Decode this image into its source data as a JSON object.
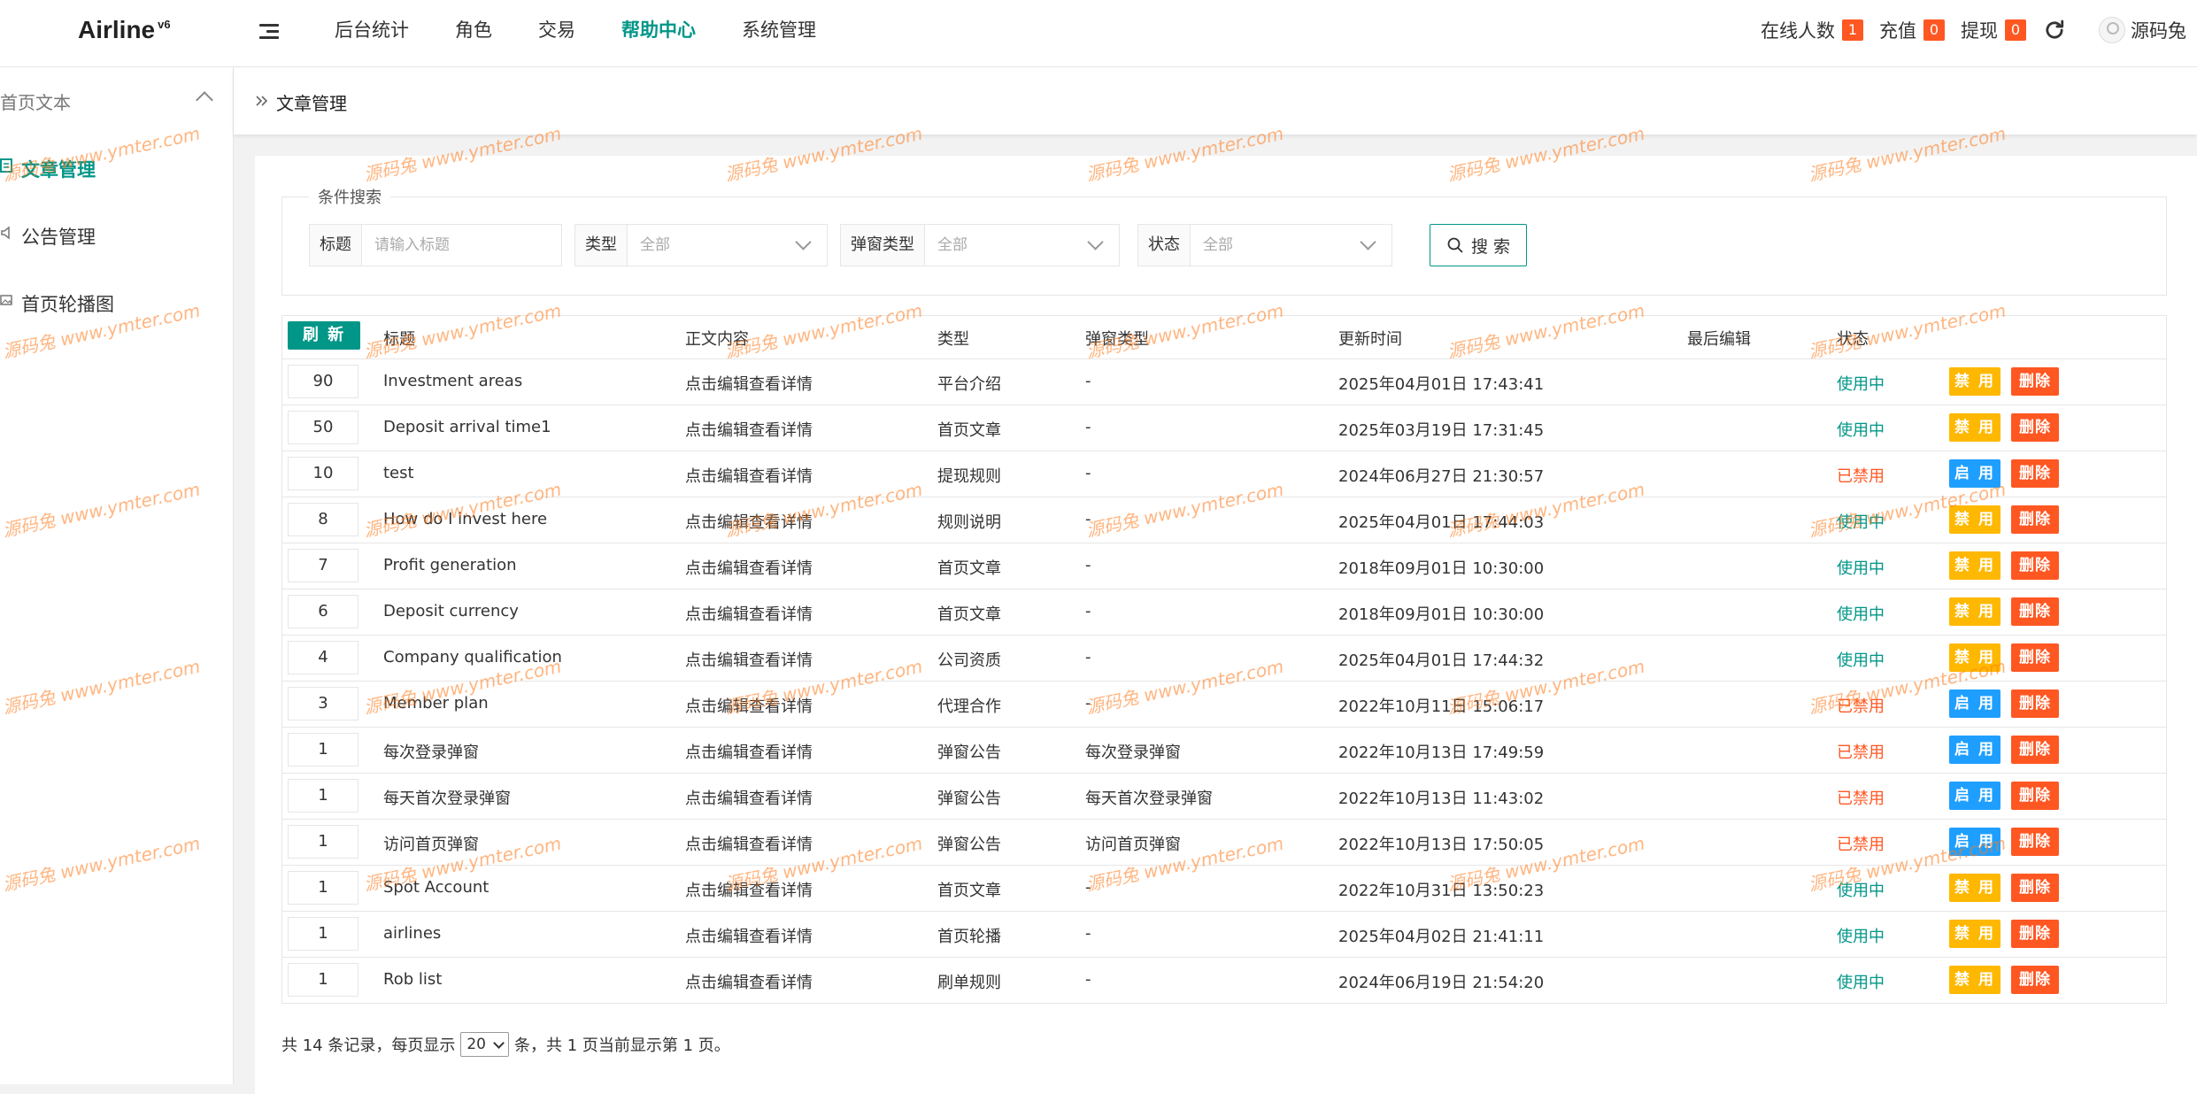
{
  "header": {
    "app_name": "Airline",
    "version": "v6",
    "nav": [
      {
        "label": "后台统计",
        "active": false
      },
      {
        "label": "角色",
        "active": false
      },
      {
        "label": "交易",
        "active": false
      },
      {
        "label": "帮助中心",
        "active": true
      },
      {
        "label": "系统管理",
        "active": false
      }
    ],
    "online_label": "在线人数",
    "online_count": "1",
    "recharge_label": "充值",
    "recharge_count": "0",
    "withdraw_label": "提现",
    "withdraw_count": "0",
    "username": "源码兔"
  },
  "sidebar": {
    "group_title": "首页文本",
    "items": [
      {
        "label": "文章管理",
        "icon": "article-icon",
        "active": true
      },
      {
        "label": "公告管理",
        "icon": "speaker-icon",
        "active": false
      },
      {
        "label": "首页轮播图",
        "icon": "image-icon",
        "active": false
      }
    ]
  },
  "breadcrumb": {
    "current": "文章管理"
  },
  "search": {
    "legend": "条件搜索",
    "title_label": "标题",
    "title_placeholder": "请输入标题",
    "type_label": "类型",
    "type_value": "全部",
    "popup_label": "弹窗类型",
    "popup_value": "全部",
    "status_label": "状态",
    "status_value": "全部",
    "button_label": "搜 索"
  },
  "table": {
    "refresh_label": "刷 新",
    "columns": [
      "标题",
      "正文内容",
      "类型",
      "弹窗类型",
      "更新时间",
      "最后编辑",
      "状态"
    ],
    "rows": [
      {
        "sort": "90",
        "title": "Investment areas",
        "content": "点击编辑查看详情",
        "type": "平台介绍",
        "popup": "-",
        "updated": "2025年04月01日 17:43:41",
        "editor": "",
        "status": "使用中",
        "enabled": true,
        "toggle": "禁 用",
        "delete": "删除"
      },
      {
        "sort": "50",
        "title": "Deposit arrival time1",
        "content": "点击编辑查看详情",
        "type": "首页文章",
        "popup": "-",
        "updated": "2025年03月19日 17:31:45",
        "editor": "",
        "status": "使用中",
        "enabled": true,
        "toggle": "禁 用",
        "delete": "删除"
      },
      {
        "sort": "10",
        "title": "test",
        "content": "点击编辑查看详情",
        "type": "提现规则",
        "popup": "-",
        "updated": "2024年06月27日 21:30:57",
        "editor": "",
        "status": "已禁用",
        "enabled": false,
        "toggle": "启 用",
        "delete": "删除"
      },
      {
        "sort": "8",
        "title": "How do I invest here",
        "content": "点击编辑查看详情",
        "type": "规则说明",
        "popup": "-",
        "updated": "2025年04月01日 17:44:03",
        "editor": "",
        "status": "使用中",
        "enabled": true,
        "toggle": "禁 用",
        "delete": "删除"
      },
      {
        "sort": "7",
        "title": "Profit generation",
        "content": "点击编辑查看详情",
        "type": "首页文章",
        "popup": "-",
        "updated": "2018年09月01日 10:30:00",
        "editor": "",
        "status": "使用中",
        "enabled": true,
        "toggle": "禁 用",
        "delete": "删除"
      },
      {
        "sort": "6",
        "title": "Deposit currency",
        "content": "点击编辑查看详情",
        "type": "首页文章",
        "popup": "-",
        "updated": "2018年09月01日 10:30:00",
        "editor": "",
        "status": "使用中",
        "enabled": true,
        "toggle": "禁 用",
        "delete": "删除"
      },
      {
        "sort": "4",
        "title": "Company qualification",
        "content": "点击编辑查看详情",
        "type": "公司资质",
        "popup": "-",
        "updated": "2025年04月01日 17:44:32",
        "editor": "",
        "status": "使用中",
        "enabled": true,
        "toggle": "禁 用",
        "delete": "删除"
      },
      {
        "sort": "3",
        "title": "Member plan",
        "content": "点击编辑查看详情",
        "type": "代理合作",
        "popup": "-",
        "updated": "2022年10月11日 15:06:17",
        "editor": "",
        "status": "已禁用",
        "enabled": false,
        "toggle": "启 用",
        "delete": "删除"
      },
      {
        "sort": "1",
        "title": "每次登录弹窗",
        "content": "点击编辑查看详情",
        "type": "弹窗公告",
        "popup": "每次登录弹窗",
        "updated": "2022年10月13日 17:49:59",
        "editor": "",
        "status": "已禁用",
        "enabled": false,
        "toggle": "启 用",
        "delete": "删除"
      },
      {
        "sort": "1",
        "title": "每天首次登录弹窗",
        "content": "点击编辑查看详情",
        "type": "弹窗公告",
        "popup": "每天首次登录弹窗",
        "updated": "2022年10月13日 11:43:02",
        "editor": "",
        "status": "已禁用",
        "enabled": false,
        "toggle": "启 用",
        "delete": "删除"
      },
      {
        "sort": "1",
        "title": "访问首页弹窗",
        "content": "点击编辑查看详情",
        "type": "弹窗公告",
        "popup": "访问首页弹窗",
        "updated": "2022年10月13日 17:50:05",
        "editor": "",
        "status": "已禁用",
        "enabled": false,
        "toggle": "启 用",
        "delete": "删除"
      },
      {
        "sort": "1",
        "title": "Spot Account",
        "content": "点击编辑查看详情",
        "type": "首页文章",
        "popup": "-",
        "updated": "2022年10月31日 13:50:23",
        "editor": "",
        "status": "使用中",
        "enabled": true,
        "toggle": "禁 用",
        "delete": "删除"
      },
      {
        "sort": "1",
        "title": "airlines",
        "content": "点击编辑查看详情",
        "type": "首页轮播",
        "popup": "-",
        "updated": "2025年04月02日 21:41:11",
        "editor": "",
        "status": "使用中",
        "enabled": true,
        "toggle": "禁 用",
        "delete": "删除"
      },
      {
        "sort": "1",
        "title": "Rob list",
        "content": "点击编辑查看详情",
        "type": "刷单规则",
        "popup": "-",
        "updated": "2024年06月19日 21:54:20",
        "editor": "",
        "status": "使用中",
        "enabled": true,
        "toggle": "禁 用",
        "delete": "删除"
      }
    ]
  },
  "pagination": {
    "prefix": "共 14 条记录，每页显示",
    "page_size": "20",
    "suffix": "条，共 1 页当前显示第 1 页。"
  },
  "watermark": {
    "text": "源码兔 www.ymter.com"
  },
  "colors": {
    "accent": "#009688",
    "danger": "#ff5722",
    "warning": "#ffb800",
    "info": "#1e9fff"
  }
}
